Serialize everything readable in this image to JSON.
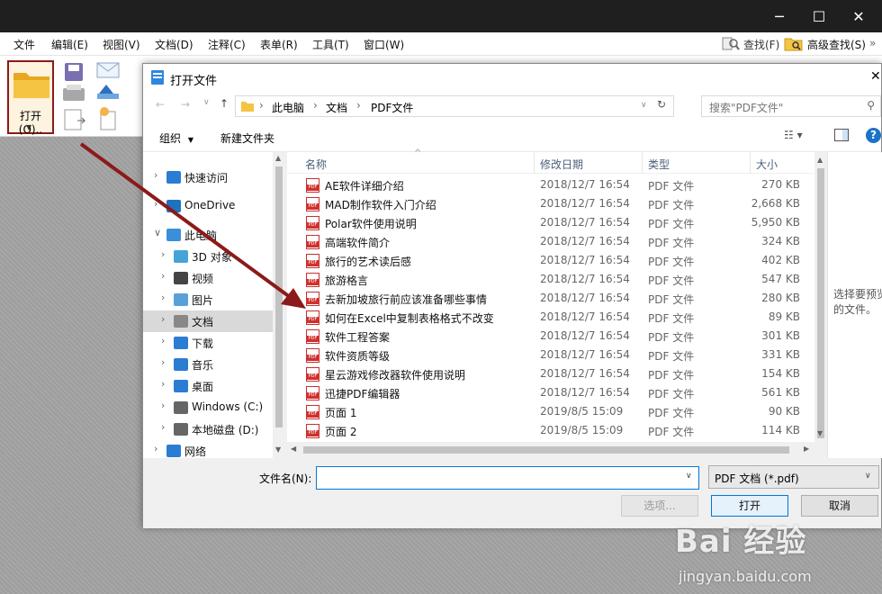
{
  "menubar": [
    "文件",
    "编辑(E)",
    "视图(V)",
    "文档(D)",
    "注释(C)",
    "表单(R)",
    "工具(T)",
    "窗口(W)"
  ],
  "toolbar_right": {
    "find": "查找(F)",
    "advanced_find": "高级查找(S)"
  },
  "ribbon": {
    "open_label": "打开(O).."
  },
  "dialog": {
    "title": "打开文件",
    "breadcrumb": [
      "此电脑",
      "文档",
      "PDF文件"
    ],
    "search_placeholder": "搜索\"PDF文件\"",
    "organize": "组织",
    "new_folder": "新建文件夹",
    "columns": {
      "name": "名称",
      "date": "修改日期",
      "type": "类型",
      "size": "大小"
    },
    "files": [
      {
        "name": "AE软件详细介绍",
        "date": "2018/12/7 16:54",
        "type": "PDF 文件",
        "size": "270 KB"
      },
      {
        "name": "MAD制作软件入门介绍",
        "date": "2018/12/7 16:54",
        "type": "PDF 文件",
        "size": "2,668 KB"
      },
      {
        "name": "Polar软件使用说明",
        "date": "2018/12/7 16:54",
        "type": "PDF 文件",
        "size": "5,950 KB"
      },
      {
        "name": "高端软件简介",
        "date": "2018/12/7 16:54",
        "type": "PDF 文件",
        "size": "324 KB"
      },
      {
        "name": "旅行的艺术读后感",
        "date": "2018/12/7 16:54",
        "type": "PDF 文件",
        "size": "402 KB"
      },
      {
        "name": "旅游格言",
        "date": "2018/12/7 16:54",
        "type": "PDF 文件",
        "size": "547 KB"
      },
      {
        "name": "去新加坡旅行前应该准备哪些事情",
        "date": "2018/12/7 16:54",
        "type": "PDF 文件",
        "size": "280 KB"
      },
      {
        "name": "如何在Excel中复制表格格式不改变",
        "date": "2018/12/7 16:54",
        "type": "PDF 文件",
        "size": "89 KB"
      },
      {
        "name": "软件工程答案",
        "date": "2018/12/7 16:54",
        "type": "PDF 文件",
        "size": "301 KB"
      },
      {
        "name": "软件资质等级",
        "date": "2018/12/7 16:54",
        "type": "PDF 文件",
        "size": "331 KB"
      },
      {
        "name": "星云游戏修改器软件使用说明",
        "date": "2018/12/7 16:54",
        "type": "PDF 文件",
        "size": "154 KB"
      },
      {
        "name": "迅捷PDF编辑器",
        "date": "2018/12/7 16:54",
        "type": "PDF 文件",
        "size": "561 KB"
      },
      {
        "name": "页面 1",
        "date": "2019/8/5 15:09",
        "type": "PDF 文件",
        "size": "90 KB"
      },
      {
        "name": "页面 2",
        "date": "2019/8/5 15:09",
        "type": "PDF 文件",
        "size": "114 KB"
      }
    ],
    "nav": [
      {
        "label": "快速访问",
        "icon": "star-icon"
      },
      {
        "label": "OneDrive",
        "icon": "cloud-icon"
      },
      {
        "label": "此电脑",
        "icon": "computer-icon"
      },
      {
        "label": "3D 对象",
        "icon": "cube-icon"
      },
      {
        "label": "视频",
        "icon": "video-icon"
      },
      {
        "label": "图片",
        "icon": "picture-icon"
      },
      {
        "label": "文档",
        "icon": "document-icon"
      },
      {
        "label": "下载",
        "icon": "download-icon"
      },
      {
        "label": "音乐",
        "icon": "music-icon"
      },
      {
        "label": "桌面",
        "icon": "desktop-icon"
      },
      {
        "label": "Windows (C:)",
        "icon": "drive-icon"
      },
      {
        "label": "本地磁盘 (D:)",
        "icon": "drive-icon"
      },
      {
        "label": "网络",
        "icon": "network-icon"
      }
    ],
    "preview_text": "选择要预览的文件。",
    "filename_label": "文件名(N):",
    "filename_value": "",
    "filetype": "PDF 文档 (*.pdf)",
    "options_button": "选项...",
    "open_button": "打开",
    "cancel_button": "取消"
  },
  "watermark": {
    "brand": "Bai 经验",
    "url": "jingyan.baidu.com"
  },
  "colors": {
    "accent": "#0078d7",
    "pdf_red": "#d0312d",
    "arrow": "#8b1a1a"
  }
}
